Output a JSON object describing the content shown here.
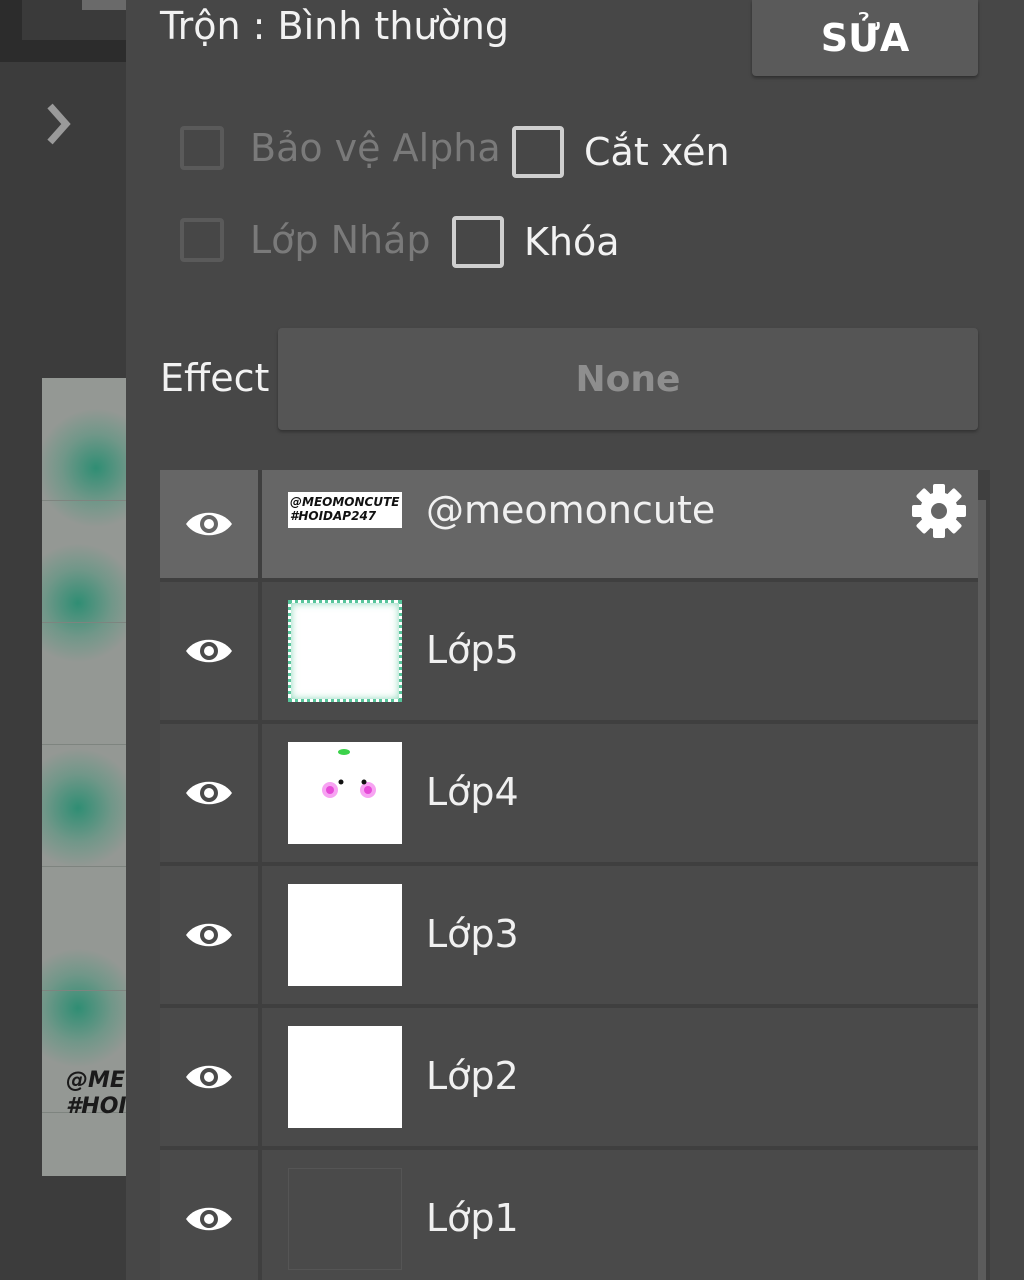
{
  "header": {
    "blend_mode_label": "Trộn : Bình thường",
    "edit_button": "SỬA"
  },
  "options": {
    "protect_alpha": {
      "label": "Bảo vệ Alpha",
      "enabled": false,
      "checked": false
    },
    "clipping": {
      "label": "Cắt xén",
      "enabled": true,
      "checked": false
    },
    "draft_layer": {
      "label": "Lớp Nháp",
      "enabled": false,
      "checked": false
    },
    "lock": {
      "label": "Khóa",
      "enabled": true,
      "checked": false
    }
  },
  "effect": {
    "label": "Effect",
    "value": "None"
  },
  "canvas_preview": {
    "watermark_text": "@ME\n#HOI"
  },
  "layers": [
    {
      "name": "@meomoncute",
      "selected": true,
      "visible": true,
      "thumbnail_text": "@MEOMONCUTE\n#HOIDAP247",
      "icon": "gear-icon"
    },
    {
      "name": "Lớp5",
      "selected": false,
      "visible": true
    },
    {
      "name": "Lớp4",
      "selected": false,
      "visible": true
    },
    {
      "name": "Lớp3",
      "selected": false,
      "visible": true
    },
    {
      "name": "Lớp2",
      "selected": false,
      "visible": true
    },
    {
      "name": "Lớp1",
      "selected": false,
      "visible": true
    }
  ],
  "colors": {
    "panel_bg": "#474747",
    "selected_row": "#666666",
    "row_bg": "#4a4a4a",
    "text": "#f2f2f2",
    "disabled_text": "#7a7a7a"
  }
}
